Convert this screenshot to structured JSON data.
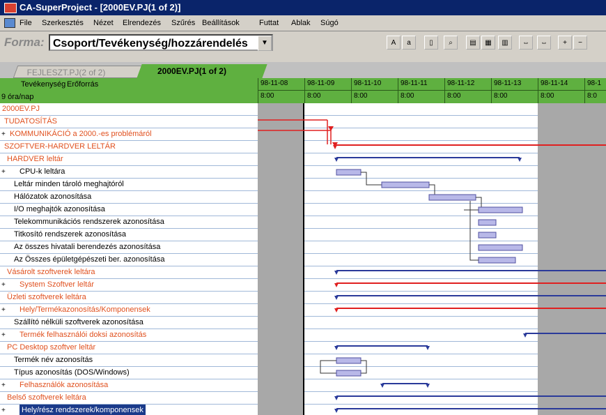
{
  "window": {
    "title": "CA-SuperProject - [2000EV.PJ(1 of 2)]"
  },
  "menu": [
    {
      "label": "File"
    },
    {
      "label": "Szerkesztés"
    },
    {
      "label": "Nézet"
    },
    {
      "label": "Elrendezés"
    },
    {
      "label": "Szűrés"
    },
    {
      "label": "Beállítások"
    },
    {
      "label": "Futtat"
    },
    {
      "label": "Ablak"
    },
    {
      "label": "Súgó"
    }
  ],
  "toolbar": {
    "forma_label": "Forma:",
    "forma_value": "Csoport/Tevékenység/hozzárendelés",
    "buttons": [
      {
        "icon": "text-large-icon"
      },
      {
        "icon": "text-small-icon"
      },
      {
        "icon": "page-icon"
      },
      {
        "icon": "search-icon"
      },
      {
        "icon": "layout-icon"
      },
      {
        "icon": "table-icon"
      },
      {
        "icon": "chart-icon"
      },
      {
        "icon": "scale-icon"
      },
      {
        "icon": "zoom-in-icon"
      },
      {
        "icon": "zoom-out-icon"
      }
    ]
  },
  "tabs": [
    {
      "label": "FEJLESZT.PJ(2 of 2)",
      "active": false
    },
    {
      "label": "2000EV.PJ(1 of 2)",
      "active": true
    }
  ],
  "columns": {
    "activity": "Tevékenység",
    "resource": "Erőforrás",
    "unit": "9 óra/nap"
  },
  "dates": [
    {
      "date": "98-11-08",
      "time": "8:00"
    },
    {
      "date": "98-11-09",
      "time": "8:00"
    },
    {
      "date": "98-11-10",
      "time": "8:00"
    },
    {
      "date": "98-11-11",
      "time": "8:00"
    },
    {
      "date": "98-11-12",
      "time": "8:00"
    },
    {
      "date": "98-11-13",
      "time": "8:00"
    },
    {
      "date": "98-11-14",
      "time": "8:00"
    },
    {
      "date": "98-1",
      "time": "8:0"
    }
  ],
  "colors": {
    "title_bar": "#0a246a",
    "header_green": "#5fb040",
    "orange_text": "#e0501e",
    "red_line": "#e02020",
    "blue_line": "#2a3a9a",
    "bar_fill": "#b8b8e8",
    "weekend_gray": "#a8a8a8",
    "row_grid": "#a0b8d8"
  },
  "tasks": [
    {
      "name": "2000EV.PJ",
      "color": "orange",
      "expand": false,
      "indent": 0
    },
    {
      "name": "TUDATOSÍTÁS",
      "color": "orange",
      "expand": false,
      "indent": 1
    },
    {
      "name": "KOMMUNIKÁCIÓ a 2000.-es problémáról",
      "color": "orange",
      "expand": true,
      "indent": 1
    },
    {
      "name": "SZOFTVER-HARDVER LELTÁR",
      "color": "orange",
      "expand": false,
      "indent": 1
    },
    {
      "name": "HARDVER leltár",
      "color": "orange",
      "expand": false,
      "indent": 2
    },
    {
      "name": "CPU-k leltára",
      "color": "black",
      "expand": true,
      "indent": 3
    },
    {
      "name": "Leltár minden tároló meghajtóról",
      "color": "black",
      "expand": false,
      "indent": 3
    },
    {
      "name": "Hálózatok azonosítása",
      "color": "black",
      "expand": false,
      "indent": 3
    },
    {
      "name": "I/O meghajtók azonosítása",
      "color": "black",
      "expand": false,
      "indent": 3
    },
    {
      "name": "Telekommunikációs rendszerek azonosítása",
      "color": "black",
      "expand": false,
      "indent": 3
    },
    {
      "name": "Titkosító rendszerek azonosítása",
      "color": "black",
      "expand": false,
      "indent": 3
    },
    {
      "name": "Az összes hivatali berendezés azonosítása",
      "color": "black",
      "expand": false,
      "indent": 3
    },
    {
      "name": "Az Összes épületgépészeti ber. azonosítása",
      "color": "black",
      "expand": false,
      "indent": 3
    },
    {
      "name": "Vásárolt szoftverek leltára",
      "color": "orange",
      "expand": false,
      "indent": 2
    },
    {
      "name": "System Szoftver leltár",
      "color": "orange",
      "expand": true,
      "indent": 3
    },
    {
      "name": "Üzleti szoftverek leltára",
      "color": "orange",
      "expand": false,
      "indent": 2
    },
    {
      "name": "Hely/Termékazonosítás/Komponensek",
      "color": "orange",
      "expand": true,
      "indent": 3
    },
    {
      "name": "Szállító nélküli szoftverek azonosítása",
      "color": "black",
      "expand": false,
      "indent": 3
    },
    {
      "name": "Termék felhasználói doksi azonosítás",
      "color": "orange",
      "expand": true,
      "indent": 3
    },
    {
      "name": "PC Desktop szoftver leltár",
      "color": "orange",
      "expand": false,
      "indent": 2
    },
    {
      "name": "Termék név azonosítás",
      "color": "black",
      "expand": false,
      "indent": 3
    },
    {
      "name": "Típus azonosítás (DOS/Windows)",
      "color": "black",
      "expand": false,
      "indent": 3
    },
    {
      "name": "Felhasználók azonosítása",
      "color": "orange",
      "expand": true,
      "indent": 3
    },
    {
      "name": "Belső szoftverek leltára",
      "color": "orange",
      "expand": false,
      "indent": 2
    },
    {
      "name": "Hely/rész rendszerek/komponensek",
      "color": "highlight",
      "expand": true,
      "indent": 3
    }
  ]
}
